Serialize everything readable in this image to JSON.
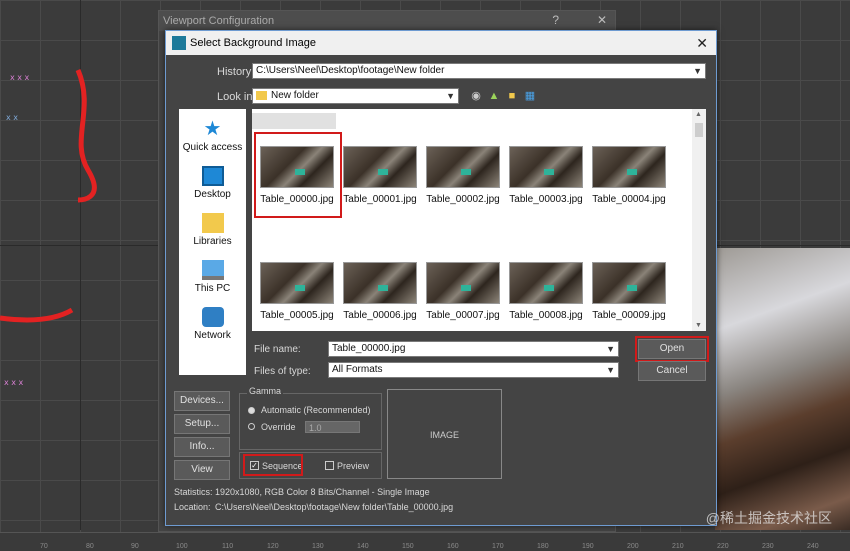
{
  "behind_window": {
    "title": "Viewport Configuration"
  },
  "dialog": {
    "title": "Select Background Image",
    "history_label": "History:",
    "history_value": "C:\\Users\\Neel\\Desktop\\footage\\New folder",
    "lookin_label": "Look in:",
    "lookin_value": "New folder",
    "toolbar_icons": [
      "back-icon",
      "up-folder-icon",
      "new-folder-icon",
      "view-menu-icon"
    ]
  },
  "sidebar": {
    "items": [
      {
        "label": "Quick access",
        "icon": "star-icon"
      },
      {
        "label": "Desktop",
        "icon": "desktop-icon"
      },
      {
        "label": "Libraries",
        "icon": "libraries-icon"
      },
      {
        "label": "This PC",
        "icon": "computer-icon"
      },
      {
        "label": "Network",
        "icon": "network-icon"
      }
    ]
  },
  "files": [
    "Table_00000.jpg",
    "Table_00001.jpg",
    "Table_00002.jpg",
    "Table_00003.jpg",
    "Table_00004.jpg",
    "Table_00005.jpg",
    "Table_00006.jpg",
    "Table_00007.jpg",
    "Table_00008.jpg",
    "Table_00009.jpg"
  ],
  "filename": {
    "label": "File name:",
    "value": "Table_00000.jpg"
  },
  "filetype": {
    "label": "Files of type:",
    "value": "All Formats"
  },
  "buttons": {
    "open": "Open",
    "cancel": "Cancel",
    "devices": "Devices...",
    "setup": "Setup...",
    "info": "Info...",
    "view": "View"
  },
  "gamma": {
    "title": "Gamma",
    "automatic": "Automatic (Recommended)",
    "override": "Override",
    "override_value": "1.0"
  },
  "sequence_label": "Sequence",
  "preview_label": "Preview",
  "preview_box_text": "IMAGE",
  "statistics": {
    "label": "Statistics:",
    "value": "1920x1080, RGB Color 8 Bits/Channel - Single Image"
  },
  "location": {
    "label": "Location:",
    "value": "C:\\Users\\Neel\\Desktop\\footage\\New folder\\Table_00000.jpg"
  },
  "ruler_ticks": [
    "70",
    "80",
    "90",
    "100",
    "110",
    "120",
    "130",
    "140",
    "150",
    "160",
    "170",
    "180",
    "190",
    "200",
    "210",
    "220",
    "230",
    "240"
  ],
  "watermark": "@稀土掘金技术社区",
  "colors": {
    "highlight_red": "#d11a1a",
    "sidebar_blue": "#1e88d6"
  }
}
